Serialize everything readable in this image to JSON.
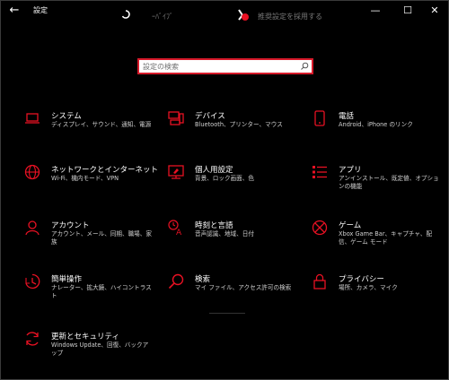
{
  "window": {
    "title": "設定",
    "back_glyph": "←",
    "minimize_glyph": "—",
    "maximize_glyph": "☐",
    "close_glyph": "✕"
  },
  "header": {
    "item1_text": "ｰﾊﾞｲﾌﾞ",
    "item2_text": "推奨設定を採用する"
  },
  "search": {
    "placeholder": "設定の検索",
    "icon": "search-icon"
  },
  "accent_color": "#e81123",
  "tiles": [
    {
      "title": "システム",
      "desc": "ディスプレイ、サウンド、通知、電源",
      "icon": "laptop-icon"
    },
    {
      "title": "デバイス",
      "desc": "Bluetooth、プリンター、マウス",
      "icon": "devices-icon"
    },
    {
      "title": "電話",
      "desc": "Android、iPhone のリンク",
      "icon": "phone-icon"
    },
    {
      "title": "ネットワークとインターネット",
      "desc": "Wi-Fi、機内モード、VPN",
      "icon": "globe-icon"
    },
    {
      "title": "個人用設定",
      "desc": "背景、ロック画面、色",
      "icon": "personalization-icon"
    },
    {
      "title": "アプリ",
      "desc": "アンインストール、既定値、オプションの機能",
      "icon": "apps-icon"
    },
    {
      "title": "アカウント",
      "desc": "アカウント、メール、同期、職場、家族",
      "icon": "person-icon"
    },
    {
      "title": "時刻と言語",
      "desc": "音声認識、地域、日付",
      "icon": "time-language-icon"
    },
    {
      "title": "ゲーム",
      "desc": "Xbox Game Bar、キャプチャ、配信、ゲーム モード",
      "icon": "xbox-icon"
    },
    {
      "title": "簡単操作",
      "desc": "ナレーター、拡大鏡、ハイコントラスト",
      "icon": "ease-of-access-icon"
    },
    {
      "title": "検索",
      "desc": "マイ ファイル、アクセス許可の検索",
      "icon": "search-icon"
    },
    {
      "title": "プライバシー",
      "desc": "場所、カメラ、マイク",
      "icon": "lock-icon"
    },
    {
      "title": "更新とセキュリティ",
      "desc": "Windows Update、回復、バックアップ",
      "icon": "update-icon"
    }
  ]
}
